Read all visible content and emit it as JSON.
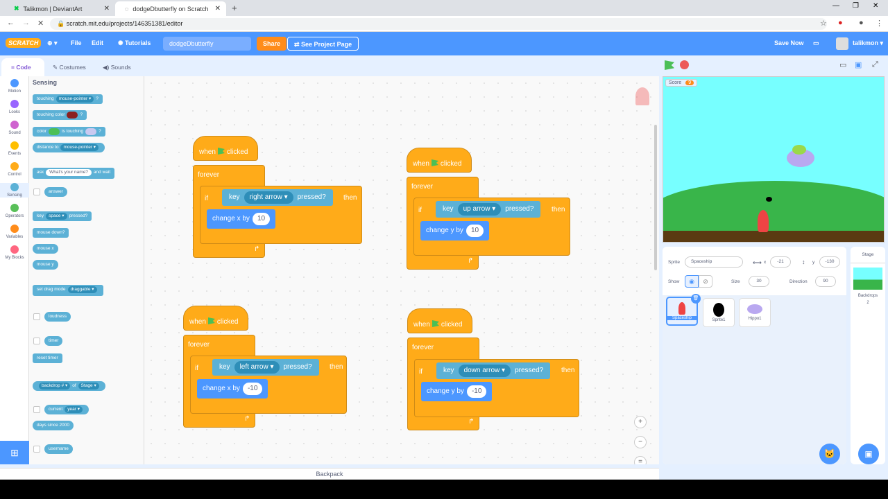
{
  "browser": {
    "tabs": [
      {
        "label": "Talikmon | DeviantArt"
      },
      {
        "label": "dodgeDbutterfly on Scratch"
      }
    ],
    "url": "scratch.mit.edu/projects/146351381/editor"
  },
  "menubar": {
    "logo": "SCRATCH",
    "file": "File",
    "edit": "Edit",
    "tutorials": "Tutorials",
    "project_title": "dodgeDbutterfly",
    "share": "Share",
    "see_project": "See Project Page",
    "save_now": "Save Now",
    "user": "talikmon"
  },
  "editor_tabs": {
    "code": "Code",
    "costumes": "Costumes",
    "sounds": "Sounds"
  },
  "categories": [
    "Motion",
    "Looks",
    "Sound",
    "Events",
    "Control",
    "Sensing",
    "Operators",
    "Variables",
    "My Blocks"
  ],
  "category_colors": [
    "#4c97ff",
    "#9966ff",
    "#cf63cf",
    "#ffbf00",
    "#ffab19",
    "#5cb1d6",
    "#59c059",
    "#ff8c1a",
    "#ff6680"
  ],
  "palette": {
    "heading": "Sensing",
    "touching": "touching",
    "mouse_pointer": "mouse-pointer",
    "q": "?",
    "touching_color": "touching color",
    "color": "color",
    "is_touching": "is touching",
    "distance_to": "distance to",
    "ask": "ask",
    "ask_default": "What's your name?",
    "and_wait": "and wait",
    "answer": "answer",
    "key": "key",
    "space": "space",
    "pressed": "pressed?",
    "mouse_down": "mouse down?",
    "mouse_x": "mouse x",
    "mouse_y": "mouse y",
    "set_drag": "set drag mode",
    "draggable": "draggable",
    "loudness": "loudness",
    "timer": "timer",
    "reset_timer": "reset timer",
    "backdrop": "backdrop #",
    "of": "of",
    "stage": "Stage",
    "current": "current",
    "year": "year",
    "days_since": "days since 2000",
    "username": "username"
  },
  "scripts": [
    {
      "when": "when",
      "clicked": "clicked",
      "forever": "forever",
      "if": "if",
      "key": "key",
      "key_name": "right arrow",
      "pressed": "pressed?",
      "then": "then",
      "action": "change x by",
      "value": "10"
    },
    {
      "when": "when",
      "clicked": "clicked",
      "forever": "forever",
      "if": "if",
      "key": "key",
      "key_name": "up arrow",
      "pressed": "pressed?",
      "then": "then",
      "action": "change y by",
      "value": "10"
    },
    {
      "when": "when",
      "clicked": "clicked",
      "forever": "forever",
      "if": "if",
      "key": "key",
      "key_name": "left arrow",
      "pressed": "pressed?",
      "then": "then",
      "action": "change x by",
      "value": "-10"
    },
    {
      "when": "when",
      "clicked": "clicked",
      "forever": "forever",
      "if": "if",
      "key": "key",
      "key_name": "down arrow",
      "pressed": "pressed?",
      "then": "then",
      "action": "change y by",
      "value": "-10"
    }
  ],
  "stage": {
    "score_label": "Score",
    "score_value": "9"
  },
  "sprite_info": {
    "sprite_label": "Sprite",
    "sprite_name": "Spaceship",
    "x_label": "x",
    "x": "-21",
    "y_label": "y",
    "y": "-130",
    "show_label": "Show",
    "size_label": "Size",
    "size": "30",
    "direction_label": "Direction",
    "direction": "90"
  },
  "sprites": [
    "Spaceship",
    "Sprite1",
    "Hippo1"
  ],
  "stage_pane": {
    "title": "Stage",
    "backdrops_label": "Backdrops",
    "backdrops_count": "2"
  },
  "backpack": "Backpack"
}
